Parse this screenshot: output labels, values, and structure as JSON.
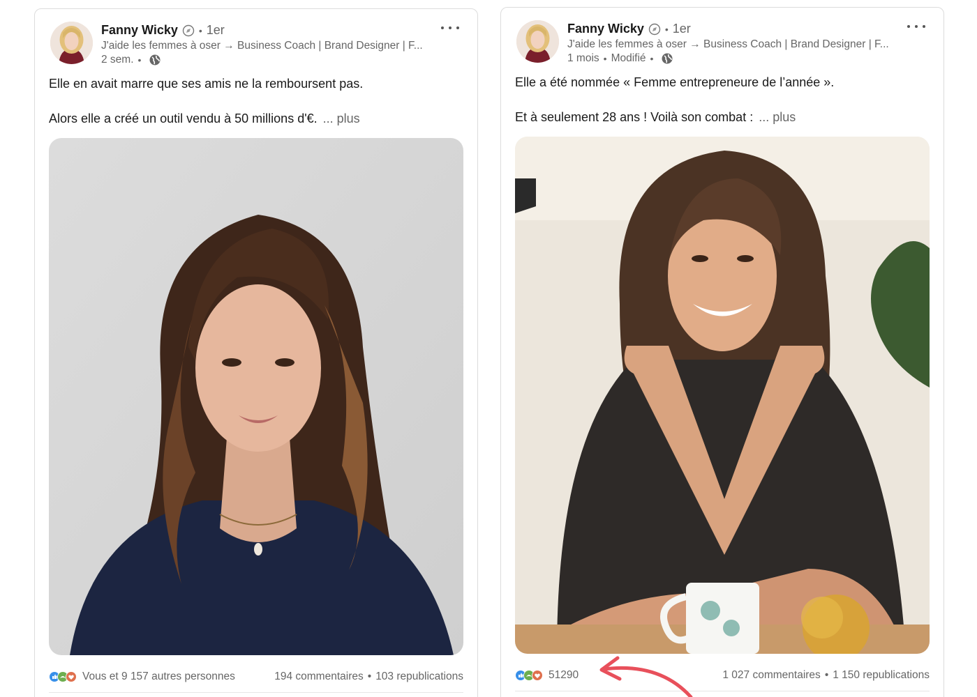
{
  "posts": [
    {
      "author": {
        "name": "Fanny Wicky",
        "degree": "1er",
        "headline": "J'aide les femmes à oser → Business Coach | Brand Designer | F..."
      },
      "timestamp": "2 sem.",
      "text_line1": "Elle en avait marre que ses amis ne la remboursent pas.",
      "text_line2": "Alors elle a créé un outil vendu à 50 millions d'€.",
      "see_more": "... plus",
      "reactions_label": "Vous et 9 157 autres personnes",
      "comments": "194 commentaires",
      "reposts": "103 republications"
    },
    {
      "author": {
        "name": "Fanny Wicky",
        "degree": "1er",
        "headline": "J'aide les femmes à oser → Business Coach | Brand Designer | F..."
      },
      "timestamp": "1 mois",
      "edited": "Modifié",
      "text_line1": "Elle a été nommée « Femme entrepreneure de l’année ».",
      "text_line2": "Et à seulement 28 ans ! Voilà son combat :",
      "see_more": "... plus",
      "reactions_label": "51290",
      "comments": "1 027 commentaires",
      "reposts": "1 150 republications"
    }
  ],
  "separator": "•",
  "icons": {
    "verified": "verified-badge-icon",
    "globe": "globe-icon",
    "more": "more-options-icon",
    "reactions": [
      "like-icon",
      "support-icon",
      "love-icon"
    ]
  },
  "colors": {
    "like": "#378fe9",
    "support": "#6dae4f",
    "love": "#df704d",
    "annotation": "#e8505b"
  }
}
